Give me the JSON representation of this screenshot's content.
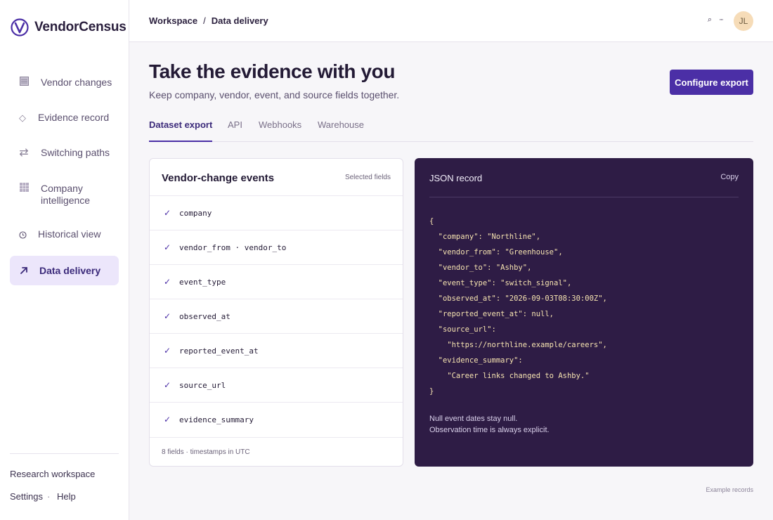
{
  "brand": {
    "name": "VendorCensus",
    "accent": "#4b2fa6"
  },
  "sidebar": {
    "items": [
      {
        "label": "Vendor changes",
        "icon": "list-icon"
      },
      {
        "label": "Evidence record",
        "icon": "diamond-icon"
      },
      {
        "label": "Switching paths",
        "icon": "arrows-swap-icon"
      },
      {
        "label": "Company intelligence",
        "icon": "grid-icon"
      },
      {
        "label": "Historical view",
        "icon": "clock-icon"
      },
      {
        "label": "Data delivery",
        "icon": "arrow-up-right-icon",
        "active": true
      }
    ],
    "footer": {
      "workspace": "Research workspace",
      "settings": "Settings",
      "dot": "·",
      "help": "Help"
    }
  },
  "header": {
    "breadcrumb": [
      "Workspace",
      "Data delivery"
    ],
    "breadcrumb_sep": "/",
    "search_glyph": "⌕",
    "more_glyph": "···",
    "avatar_initials": "JL"
  },
  "main": {
    "title": "Take the evidence with you",
    "subtitle": "Keep company, vendor, event, and source fields together.",
    "configure_button": "Configure export",
    "tabs": [
      {
        "label": "Dataset export",
        "active": true
      },
      {
        "label": "API"
      },
      {
        "label": "Webhooks"
      },
      {
        "label": "Warehouse"
      }
    ],
    "fields_card": {
      "title": "Vendor-change events",
      "meta": "Selected fields",
      "check_glyph": "✓",
      "fields": [
        "company",
        "vendor_from · vendor_to",
        "event_type",
        "observed_at",
        "reported_event_at",
        "source_url",
        "evidence_summary"
      ],
      "footer": "8 fields · timestamps in UTC"
    },
    "json_card": {
      "title": "JSON record",
      "copy_label": "Copy",
      "lines": [
        "{",
        "  \"company\": \"Northline\",",
        "  \"vendor_from\": \"Greenhouse\",",
        "  \"vendor_to\": \"Ashby\",",
        "  \"event_type\": \"switch_signal\",",
        "  \"observed_at\": \"2026-09-03T08:30:00Z\",",
        "  \"reported_event_at\": null,",
        "  \"source_url\":",
        "    \"https://northline.example/careers\",",
        "  \"evidence_summary\":",
        "    \"Career links changed to Ashby.\"",
        "}"
      ],
      "note_1": "Null event dates stay null.",
      "note_2": "Observation time is always explicit."
    },
    "example_label": "Example records"
  }
}
